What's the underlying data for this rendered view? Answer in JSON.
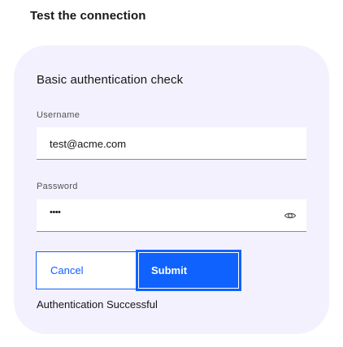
{
  "header": {
    "title": "Test the connection"
  },
  "card": {
    "title": "Basic authentication check",
    "username": {
      "label": "Username",
      "value": "test@acme.com"
    },
    "password": {
      "label": "Password",
      "masked_value": "••••",
      "toggle_icon": "eye-icon"
    },
    "buttons": {
      "cancel_label": "Cancel",
      "submit_label": "Submit"
    },
    "status": "Authentication Successful"
  },
  "colors": {
    "accent": "#0f62fe",
    "card_background": "#f4f1fe",
    "text": "#161616"
  }
}
